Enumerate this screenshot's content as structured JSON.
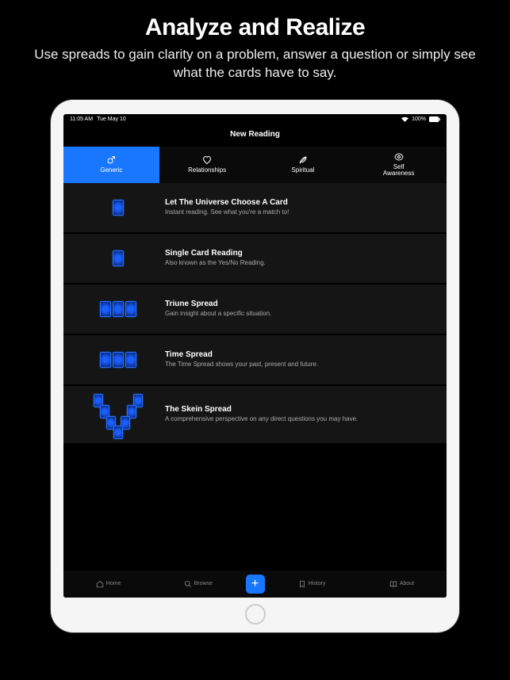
{
  "page": {
    "title": "Analyze and Realize",
    "subtitle": "Use spreads to gain clarity on a problem, answer a question or simply see what the cards have to say."
  },
  "status_bar": {
    "time": "11:05 AM",
    "date": "Tue May 10",
    "battery": "100%"
  },
  "nav_title": "New Reading",
  "tabs": [
    {
      "label": "Generic",
      "icon": "male-icon",
      "active": true
    },
    {
      "label": "Relationships",
      "icon": "heart-icon",
      "active": false
    },
    {
      "label": "Spiritual",
      "icon": "feather-icon",
      "active": false
    },
    {
      "label": "Self\nAwareness",
      "icon": "eye-icon",
      "active": false
    }
  ],
  "spreads": [
    {
      "title": "Let The Universe Choose A Card",
      "desc": "Instant reading. See what you're a match to!",
      "cards": 1
    },
    {
      "title": "Single Card Reading",
      "desc": "Also known as the Yes/No Reading.",
      "cards": 1
    },
    {
      "title": "Triune Spread",
      "desc": "Gain insight about a specific situation.",
      "cards": 3
    },
    {
      "title": "Time Spread",
      "desc": "The Time Spread shows your past, present and future.",
      "cards": 3
    },
    {
      "title": "The Skein Spread",
      "desc": "A comprehensive perspective on any direct questions you may have.",
      "cards": 7,
      "layout": "v"
    }
  ],
  "bottom_nav": [
    {
      "label": "Home",
      "icon": "home-icon"
    },
    {
      "label": "Browse",
      "icon": "search-icon"
    },
    {
      "label": "",
      "icon": "plus-icon",
      "center": true
    },
    {
      "label": "History",
      "icon": "bookmark-icon"
    },
    {
      "label": "About",
      "icon": "book-icon"
    }
  ]
}
